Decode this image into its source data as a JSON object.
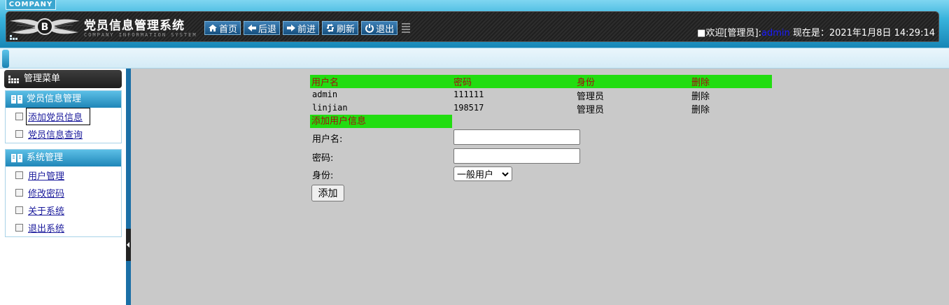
{
  "header": {
    "company_tag": "COMPANY",
    "title": "党员信息管理系统",
    "subtitle": "COMPANY INFORMATION SYSTEM",
    "nav": [
      {
        "label": "首页",
        "icon": "home-icon"
      },
      {
        "label": "后退",
        "icon": "arrow-left-icon"
      },
      {
        "label": "前进",
        "icon": "arrow-right-icon"
      },
      {
        "label": "刷新",
        "icon": "refresh-icon"
      },
      {
        "label": "退出",
        "icon": "power-icon"
      }
    ],
    "welcome_prefix": "■欢迎[管理员]:",
    "username": "admin",
    "datetime_label": " 现在是：2021年1月8日 14:29:14"
  },
  "sidebar": {
    "menu_title": "管理菜单",
    "groups": [
      {
        "title": "党员信息管理",
        "items": [
          {
            "label": "添加党员信息"
          },
          {
            "label": "党员信息查询"
          }
        ]
      },
      {
        "title": "系统管理",
        "items": [
          {
            "label": "用户管理"
          },
          {
            "label": "修改密码"
          },
          {
            "label": "关于系统"
          },
          {
            "label": "退出系统"
          }
        ]
      }
    ]
  },
  "main": {
    "columns": [
      "用户名",
      "密码",
      "身份",
      "删除"
    ],
    "rows": [
      {
        "username": "admin",
        "password": "111111",
        "role": "管理员",
        "action": "删除"
      },
      {
        "username": "linjian",
        "password": "198517",
        "role": "管理员",
        "action": "删除"
      }
    ],
    "add_form": {
      "title": "添加用户信息",
      "username_label": "用户名:",
      "username_value": "",
      "password_label": "密码:",
      "password_value": "",
      "role_label": "身份:",
      "role_selected": "一般用户",
      "submit_label": "添加"
    }
  },
  "colors": {
    "table_header_bg": "#22dd11",
    "table_header_text": "#a01010",
    "content_bg": "#c9c9c9",
    "header_accent": "#1786b6"
  }
}
